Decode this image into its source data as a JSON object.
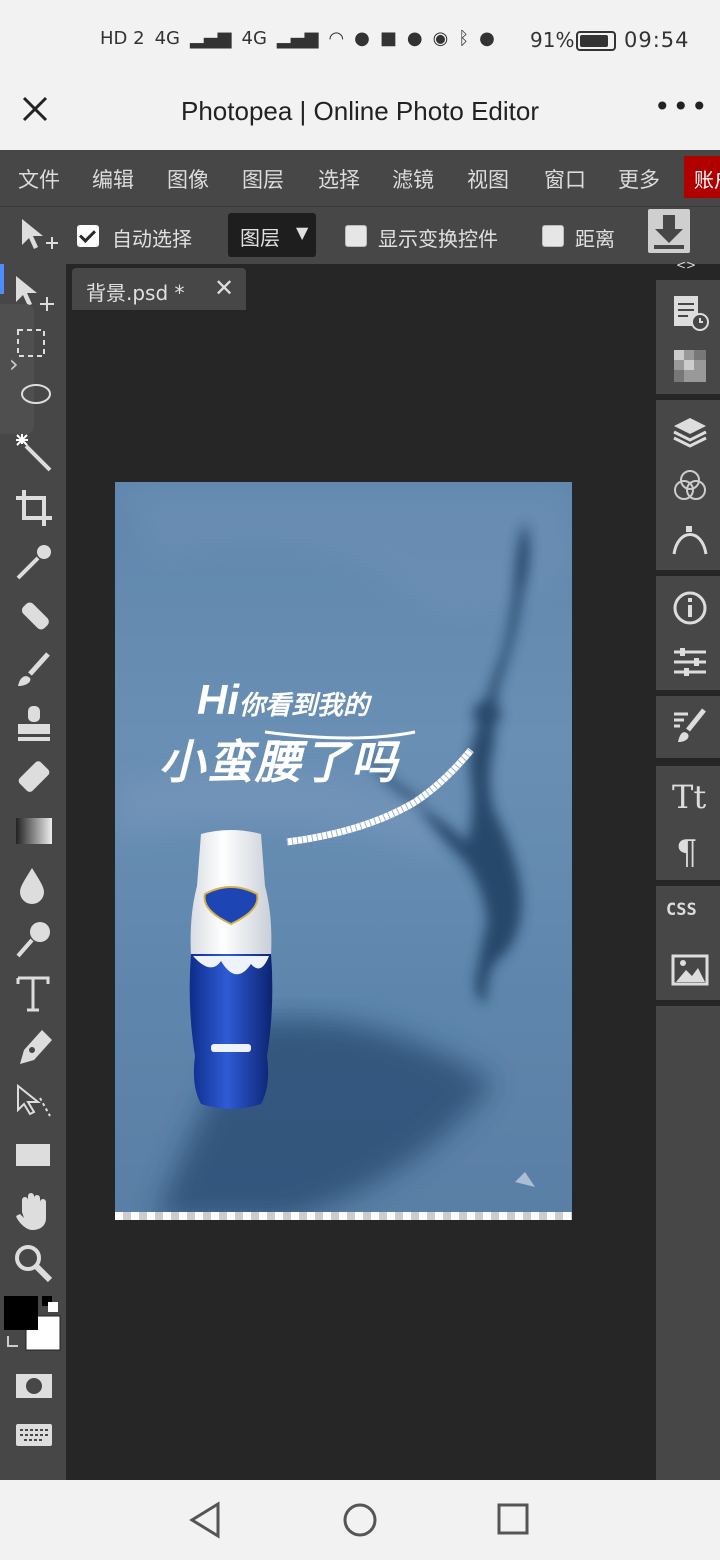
{
  "status_bar": {
    "network": [
      "HD 2",
      "4G",
      "4G"
    ],
    "app_icons": [
      "wifi-icon",
      "wechat-icon",
      "soul-app-icon",
      "wechat-icon",
      "qq-icon",
      "alarm-icon",
      "bluetooth-icon",
      "mic-icon",
      "mute-icon"
    ],
    "battery": "91%",
    "time": "09:54"
  },
  "browser": {
    "title": "Photopea | Online Photo Editor",
    "more": "•••"
  },
  "menu": {
    "items": [
      "文件",
      "编辑",
      "图像",
      "图层",
      "选择",
      "滤镜",
      "视图",
      "窗口",
      "更多"
    ],
    "account": "账户"
  },
  "options": {
    "auto_select_label": "自动选择",
    "auto_select_checked": true,
    "target_select": "图层",
    "show_transform_label": "显示变换控件",
    "show_transform_checked": false,
    "distance_label": "距离",
    "distance_checked": false
  },
  "document": {
    "tab_name": "背景.psd *",
    "close": "✕"
  },
  "canvas": {
    "headline": "Hi",
    "headline_suffix": "你看到我的",
    "slogan": "小蛮腰了吗"
  },
  "right_panel": {
    "toggle": "<>",
    "css_label": "CSS"
  },
  "colors": {
    "accent": "#4e8cff",
    "account_bg": "#b10000",
    "panel": "#474747",
    "workspace": "#262626"
  }
}
